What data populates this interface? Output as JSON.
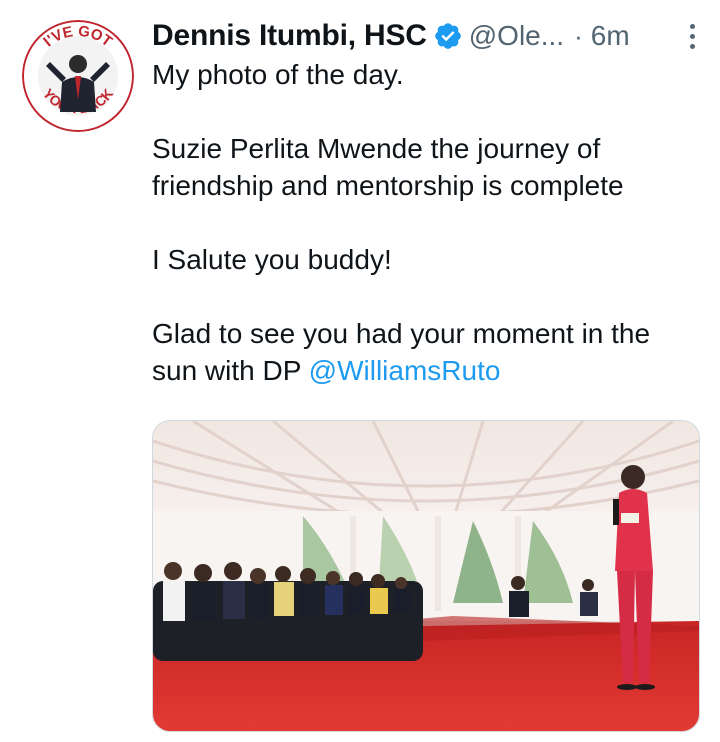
{
  "tweet": {
    "display_name": "Dennis Itumbi, HSC",
    "handle": "@Ole...",
    "separator": "·",
    "time": "6m",
    "paragraphs": [
      "My photo of the day.",
      "Suzie Perlita Mwende the journey of friendship and mentorship is complete",
      "I Salute you buddy!"
    ],
    "last_paragraph_text": "Glad to see you had your moment in the sun with DP ",
    "mention": "@WilliamsRuto"
  },
  "avatar": {
    "arc_text_top": "I'VE GOT",
    "arc_text_bottom": "YOUR BACK"
  },
  "icons": {
    "verified": "verified-badge-icon",
    "more": "more-options-icon"
  },
  "colors": {
    "accent": "#1d9bf0",
    "secondary_text": "#536471",
    "carpet": "#d62b2b",
    "dress": "#e0334b"
  }
}
